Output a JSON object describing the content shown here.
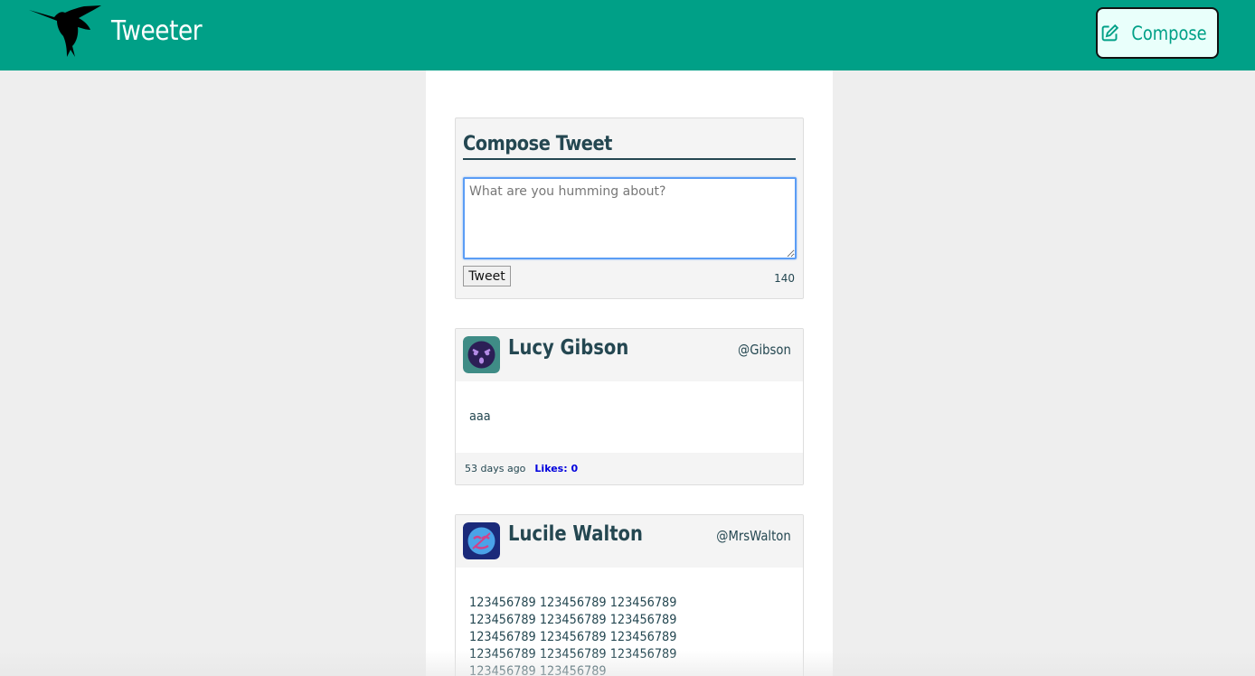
{
  "nav": {
    "brand": "Tweeter",
    "compose_label": "Compose",
    "logo_icon": "hummingbird-icon",
    "compose_icon": "edit-icon"
  },
  "new_tweet": {
    "title": "Compose Tweet",
    "placeholder": "What are you humming about?",
    "submit_label": "Tweet",
    "counter": "140"
  },
  "tweets": [
    {
      "name": "Lucy Gibson",
      "handle": "@Gibson",
      "content": "aaa",
      "time": "53 days ago",
      "likes": "Likes: 0",
      "avatar_icon": "avatar-face-icon"
    },
    {
      "name": "Lucile Walton",
      "handle": "@MrsWalton",
      "content": "123456789 123456789 123456789 123456789 123456789 123456789 123456789 123456789 123456789 123456789 123456789 123456789 123456789 123456789",
      "avatar_icon": "avatar-face-icon"
    }
  ],
  "colors": {
    "brand": "#00a087",
    "text": "#244751",
    "likes": "#0000dd"
  }
}
